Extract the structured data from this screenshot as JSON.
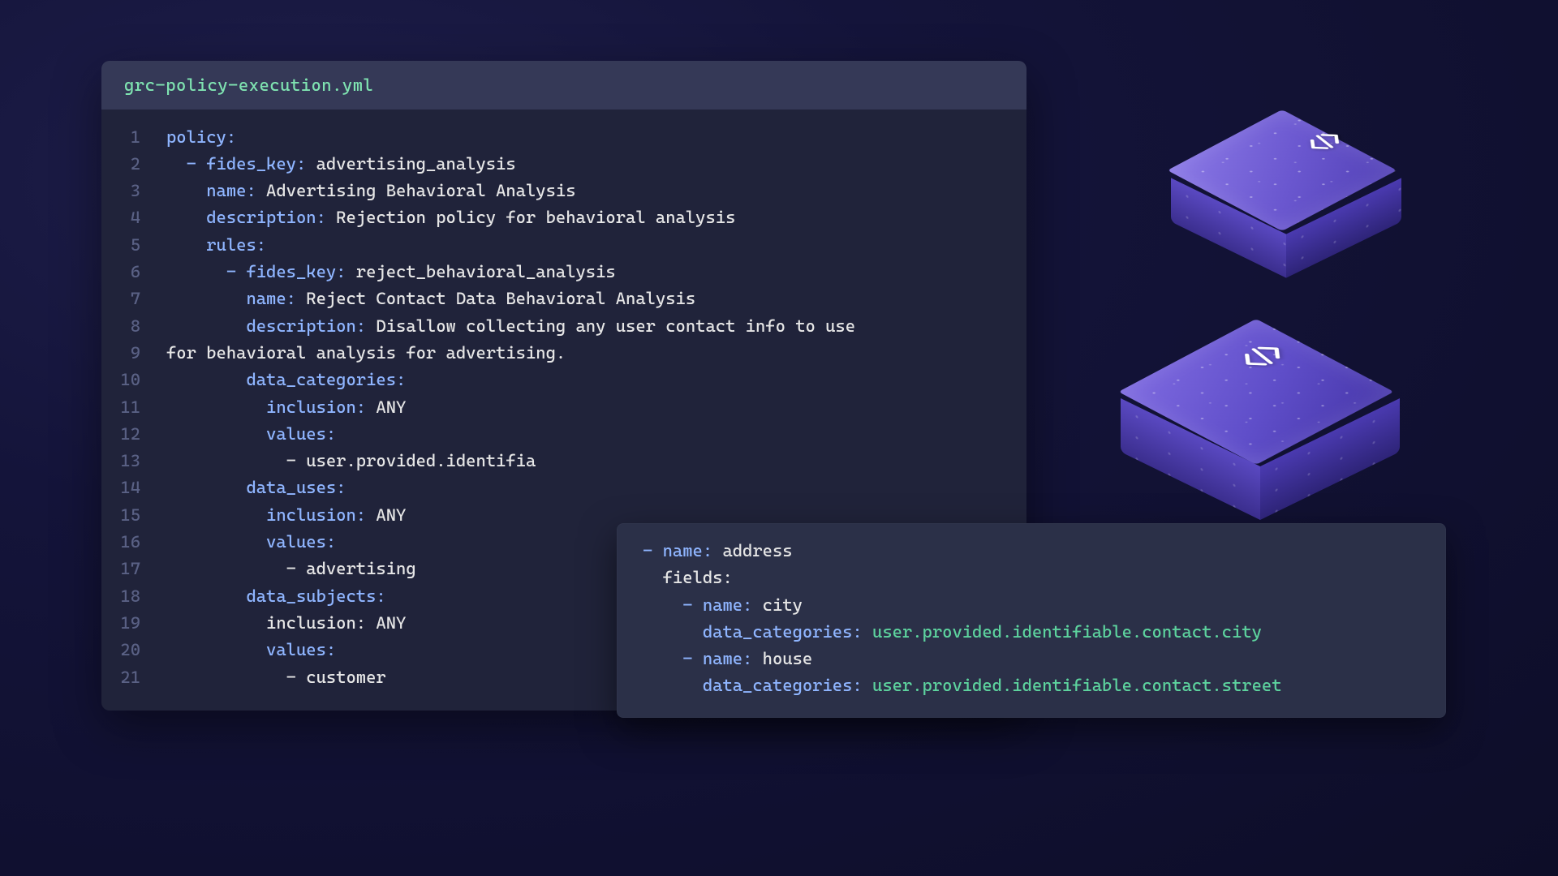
{
  "editor": {
    "filename": "grc-policy-execution.yml",
    "lines": [
      [
        {
          "t": "policy:",
          "c": "kw",
          "ind": 0
        }
      ],
      [
        {
          "t": "- ",
          "c": "dash",
          "ind": 1
        },
        {
          "t": "fides_key:",
          "c": "kw"
        },
        {
          "t": " advertising_analysis",
          "c": "str"
        }
      ],
      [
        {
          "t": "name:",
          "c": "kw",
          "ind": 2
        },
        {
          "t": " Advertising Behavioral Analysis",
          "c": "str"
        }
      ],
      [
        {
          "t": "description:",
          "c": "kw",
          "ind": 2
        },
        {
          "t": " Rejection policy for behavioral analysis",
          "c": "str"
        }
      ],
      [
        {
          "t": "rules:",
          "c": "kw",
          "ind": 2
        }
      ],
      [
        {
          "t": "- ",
          "c": "dash",
          "ind": 3
        },
        {
          "t": "fides_key:",
          "c": "kw"
        },
        {
          "t": " reject_behavioral_analysis",
          "c": "str"
        }
      ],
      [
        {
          "t": "name:",
          "c": "kw",
          "ind": 4
        },
        {
          "t": " Reject Contact Data Behavioral Analysis",
          "c": "str"
        }
      ],
      [
        {
          "t": "description:",
          "c": "kw",
          "ind": 4
        },
        {
          "t": " Disallow collecting any user contact info to use",
          "c": "str"
        }
      ],
      [
        {
          "t": "for behavioral analysis for advertising.",
          "c": "str",
          "ind": 0
        }
      ],
      [
        {
          "t": "data_categories:",
          "c": "kw",
          "ind": 4
        }
      ],
      [
        {
          "t": "inclusion:",
          "c": "kw",
          "ind": 5
        },
        {
          "t": " ANY",
          "c": "str"
        }
      ],
      [
        {
          "t": "values:",
          "c": "kw",
          "ind": 5
        }
      ],
      [
        {
          "t": "- user.provided.identifia",
          "c": "str",
          "ind": 6
        }
      ],
      [
        {
          "t": "data_uses:",
          "c": "kw",
          "ind": 4
        }
      ],
      [
        {
          "t": "inclusion:",
          "c": "kw",
          "ind": 5
        },
        {
          "t": " ANY",
          "c": "str"
        }
      ],
      [
        {
          "t": "values:",
          "c": "kw",
          "ind": 5
        }
      ],
      [
        {
          "t": "- advertising",
          "c": "str",
          "ind": 6
        }
      ],
      [
        {
          "t": "data_subjects:",
          "c": "kw",
          "ind": 4
        }
      ],
      [
        {
          "t": "inclusion:",
          "c": "str",
          "ind": 5
        },
        {
          "t": " ANY",
          "c": "str"
        }
      ],
      [
        {
          "t": "values:",
          "c": "kw",
          "ind": 5
        }
      ],
      [
        {
          "t": "- customer",
          "c": "str",
          "ind": 6
        }
      ]
    ]
  },
  "overlay": {
    "lines": [
      [
        {
          "t": "- ",
          "c": "ov-dash",
          "ind": 0
        },
        {
          "t": "name:",
          "c": "ov-key"
        },
        {
          "t": " address",
          "c": "ov-str"
        }
      ],
      [
        {
          "t": "fields:",
          "c": "ov-str",
          "ind": 1
        }
      ],
      [
        {
          "t": "- ",
          "c": "ov-dash",
          "ind": 2
        },
        {
          "t": "name:",
          "c": "ov-key"
        },
        {
          "t": " city",
          "c": "ov-str"
        }
      ],
      [
        {
          "t": "data_categories:",
          "c": "ov-key",
          "ind": 3
        },
        {
          "t": " user.provided.identifiable.contact.city",
          "c": "ov-green"
        }
      ],
      [
        {
          "t": "- ",
          "c": "ov-dash",
          "ind": 2
        },
        {
          "t": "name:",
          "c": "ov-key"
        },
        {
          "t": " house",
          "c": "ov-str"
        }
      ],
      [
        {
          "t": "data_categories:",
          "c": "ov-key",
          "ind": 3
        },
        {
          "t": " user.provided.identifiable.contact.street",
          "c": "ov-green"
        }
      ]
    ]
  },
  "decoration": {
    "emblem": "code-bracket-icon"
  }
}
